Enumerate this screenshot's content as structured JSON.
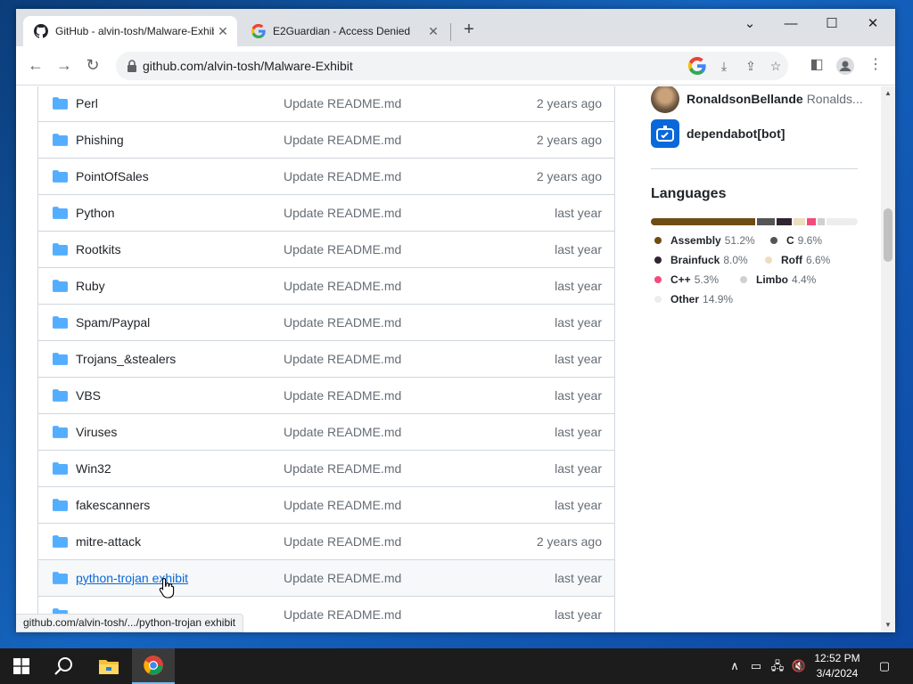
{
  "browser": {
    "tabs": [
      {
        "title": "GitHub - alvin-tosh/Malware-Exhibit",
        "favicon": "github-icon",
        "active": true
      },
      {
        "title": "E2Guardian - Access Denied",
        "favicon": "google-icon",
        "active": false
      }
    ],
    "url": "github.com/alvin-tosh/Malware-Exhibit",
    "status_url": "github.com/alvin-tosh/.../python-trojan exhibit"
  },
  "files": [
    {
      "name": "Perl",
      "commit": "Update README.md",
      "age": "2 years ago"
    },
    {
      "name": "Phishing",
      "commit": "Update README.md",
      "age": "2 years ago"
    },
    {
      "name": "PointOfSales",
      "commit": "Update README.md",
      "age": "2 years ago"
    },
    {
      "name": "Python",
      "commit": "Update README.md",
      "age": "last year"
    },
    {
      "name": "Rootkits",
      "commit": "Update README.md",
      "age": "last year"
    },
    {
      "name": "Ruby",
      "commit": "Update README.md",
      "age": "last year"
    },
    {
      "name": "Spam/Paypal",
      "commit": "Update README.md",
      "age": "last year"
    },
    {
      "name": "Trojans_&stealers",
      "commit": "Update README.md",
      "age": "last year"
    },
    {
      "name": "VBS",
      "commit": "Update README.md",
      "age": "last year"
    },
    {
      "name": "Viruses",
      "commit": "Update README.md",
      "age": "last year"
    },
    {
      "name": "Win32",
      "commit": "Update README.md",
      "age": "last year"
    },
    {
      "name": "fakescanners",
      "commit": "Update README.md",
      "age": "last year"
    },
    {
      "name": "mitre-attack",
      "commit": "Update README.md",
      "age": "2 years ago"
    },
    {
      "name": "python-trojan exhibit",
      "commit": "Update README.md",
      "age": "last year",
      "hovered": true
    },
    {
      "name": "",
      "commit": "Update README.md",
      "age": "last year"
    }
  ],
  "contributors": [
    {
      "name": "RonaldsonBellande",
      "handle": "Ronalds..."
    },
    {
      "name": "dependabot[bot]",
      "handle": ""
    }
  ],
  "languages": {
    "title": "Languages",
    "items": [
      {
        "name": "Assembly",
        "pct": "51.2%",
        "value": 51.2,
        "color": "#6E4C13"
      },
      {
        "name": "C",
        "pct": "9.6%",
        "value": 9.6,
        "color": "#555555"
      },
      {
        "name": "Brainfuck",
        "pct": "8.0%",
        "value": 8.0,
        "color": "#2F2530"
      },
      {
        "name": "Roff",
        "pct": "6.6%",
        "value": 6.6,
        "color": "#ECDEBE"
      },
      {
        "name": "C++",
        "pct": "5.3%",
        "value": 5.3,
        "color": "#F34B7D"
      },
      {
        "name": "Limbo",
        "pct": "4.4%",
        "value": 4.4,
        "color": "#D0D0D0"
      },
      {
        "name": "Other",
        "pct": "14.9%",
        "value": 14.9,
        "color": "#EDEDED"
      }
    ]
  },
  "taskbar": {
    "time": "12:52 PM",
    "date": "3/4/2024"
  }
}
